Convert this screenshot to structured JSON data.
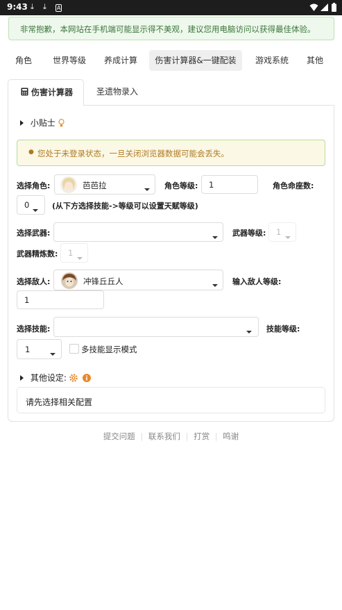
{
  "status_bar": {
    "time": "9:43",
    "left_icons": [
      "download-icon",
      "download-icon",
      "a-box-icon"
    ],
    "right_icons": [
      "wifi-icon",
      "signal-icon",
      "battery-icon"
    ]
  },
  "notice": "非常抱歉，本网站在手机端可能显示得不美观，建议您用电脑访问以获得最佳体验。",
  "nav_tabs": [
    "角色",
    "世界等级",
    "养成计算",
    "伤害计算器&一键配装",
    "游戏系统",
    "其他"
  ],
  "sub_tabs": {
    "calculator": "伤害计算器",
    "artifact": "圣遗物录入"
  },
  "tips_label": "小贴士",
  "warning": "您处于未登录状态，一旦关闭浏览器数据可能会丢失。",
  "form": {
    "character_label": "选择角色:",
    "character_value": "芭芭拉",
    "char_level_label": "角色等级:",
    "char_level_value": "1",
    "constellation_label": "角色命座数:",
    "constellation_value": "0",
    "constellation_hint": "(从下方选择技能->等级可以设置天赋等级)",
    "weapon_label": "选择武器:",
    "weapon_value": "",
    "weapon_level_label": "武器等级:",
    "weapon_level_value": "1",
    "refine_label": "武器精炼数:",
    "refine_value": "1",
    "enemy_label": "选择敌人:",
    "enemy_value": "冲锋丘丘人",
    "enemy_level_label": "输入敌人等级:",
    "enemy_level_value": "1",
    "skill_label": "选择技能:",
    "skill_value": "",
    "skill_level_label": "技能等级:",
    "skill_level_value": "1",
    "multi_skill_label": "多技能显示模式"
  },
  "other_settings_label": "其他设定:",
  "result_text": "请先选择相关配置",
  "footer_links": [
    "提交问题",
    "联系我们",
    "打赏",
    "鸣谢"
  ],
  "colors": {
    "notice_bg": "#eef8ec",
    "notice_text": "#3c763d",
    "warn_text": "#b07a22",
    "gear": "#e8892a",
    "info": "#e8892a"
  }
}
